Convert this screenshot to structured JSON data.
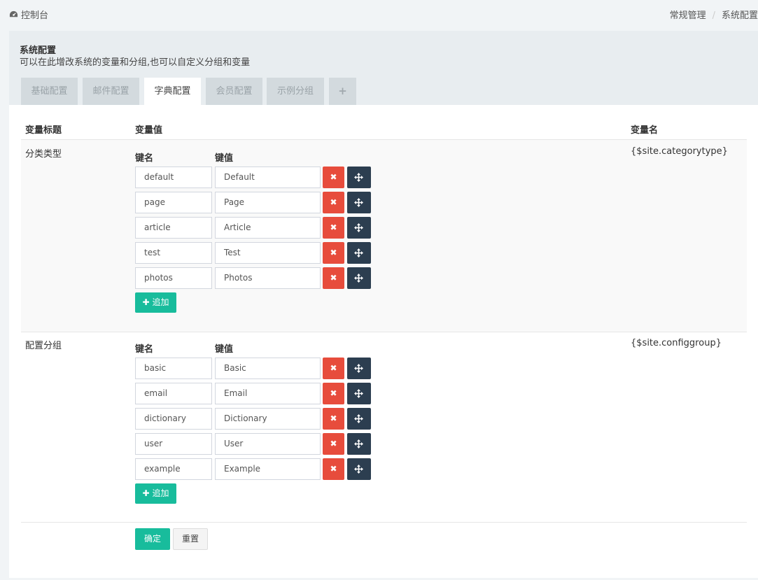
{
  "breadcrumb": {
    "home": "控制台",
    "home_icon": "dashboard-icon",
    "path": [
      "常规管理",
      "系统配置"
    ],
    "separator": "/"
  },
  "panel": {
    "title": "系统配置",
    "description": "可以在此增改系统的变量和分组,也可以自定义分组和变量"
  },
  "tabs": [
    {
      "label": "基础配置",
      "active": false
    },
    {
      "label": "邮件配置",
      "active": false
    },
    {
      "label": "字典配置",
      "active": true
    },
    {
      "label": "会员配置",
      "active": false
    },
    {
      "label": "示例分组",
      "active": false
    },
    {
      "label": "+",
      "active": false
    }
  ],
  "table_headers": {
    "title": "变量标题",
    "value": "变量值",
    "name": "变量名"
  },
  "rows": [
    {
      "title": "分类类型",
      "var_name": "{$site.categorytype}",
      "key_header": "键名",
      "value_header": "键值",
      "pairs": [
        {
          "key": "default",
          "value": "Default"
        },
        {
          "key": "page",
          "value": "Page"
        },
        {
          "key": "article",
          "value": "Article"
        },
        {
          "key": "test",
          "value": "Test"
        },
        {
          "key": "photos",
          "value": "Photos"
        }
      ],
      "add_label": "追加"
    },
    {
      "title": "配置分组",
      "var_name": "{$site.configgroup}",
      "key_header": "键名",
      "value_header": "键值",
      "pairs": [
        {
          "key": "basic",
          "value": "Basic"
        },
        {
          "key": "email",
          "value": "Email"
        },
        {
          "key": "dictionary",
          "value": "Dictionary"
        },
        {
          "key": "user",
          "value": "User"
        },
        {
          "key": "example",
          "value": "Example"
        }
      ],
      "add_label": "追加"
    }
  ],
  "buttons": {
    "delete_icon": "close-icon",
    "move_icon": "move-arrows-icon",
    "add_icon": "plus-icon",
    "submit": "确定",
    "reset": "重置"
  },
  "colors": {
    "success": "#18bc9c",
    "danger": "#e74c3c",
    "dark": "#2c3e50",
    "tab_bg": "#d3dade"
  }
}
